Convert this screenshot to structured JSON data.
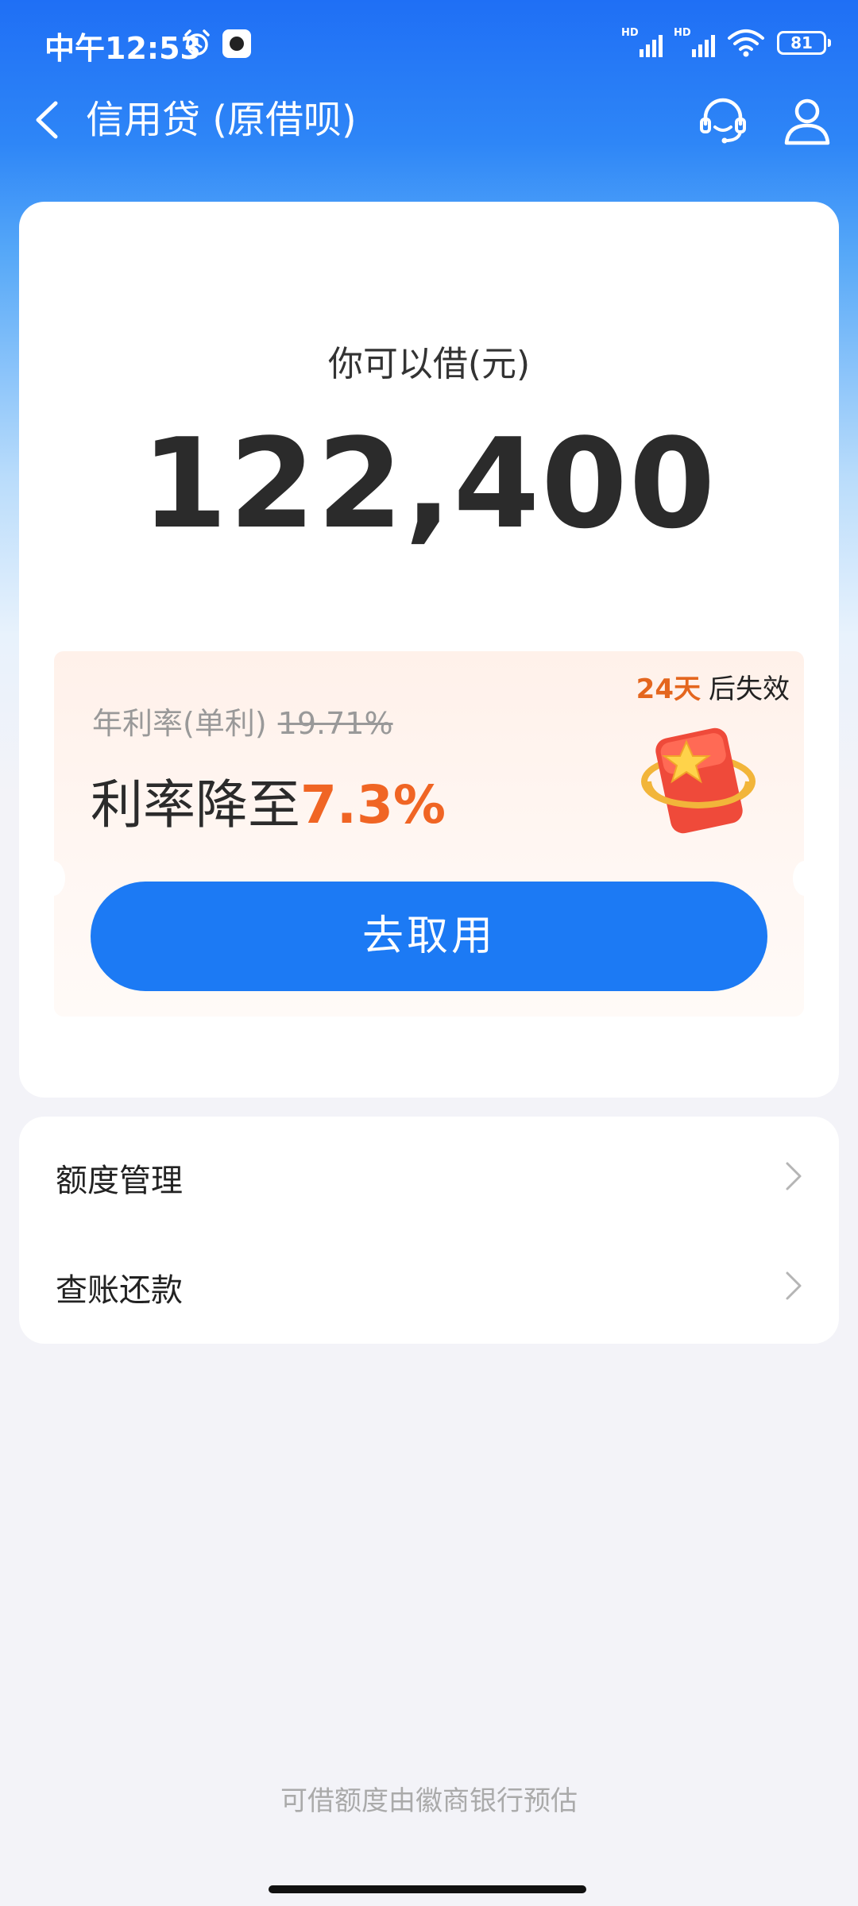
{
  "status_bar": {
    "time": "中午12:53",
    "signal1_label": "HD",
    "signal2_label": "HD",
    "battery": "81"
  },
  "nav": {
    "title": "信用贷 (原借呗)",
    "back_icon": "chevron-left-icon",
    "service_icon": "headset-icon",
    "user_icon": "user-icon"
  },
  "main": {
    "borrow_label": "你可以借(元)",
    "amount": "122,400",
    "coupon": {
      "expiry_days": "24天",
      "expiry_suffix": "后失效",
      "rate_label": "年利率(单利)",
      "rate_original": "19.71%",
      "rate_prefix": "利率降至",
      "rate_new": "7.3%",
      "cta": "去取用"
    }
  },
  "menu": {
    "items": [
      {
        "label": "额度管理"
      },
      {
        "label": "查账还款"
      }
    ]
  },
  "footer": {
    "note": "可借额度由徽商银行预估"
  },
  "colors": {
    "primary_blue": "#1c7af4",
    "accent_orange": "#f06524",
    "expiry_orange": "#e4661e"
  }
}
